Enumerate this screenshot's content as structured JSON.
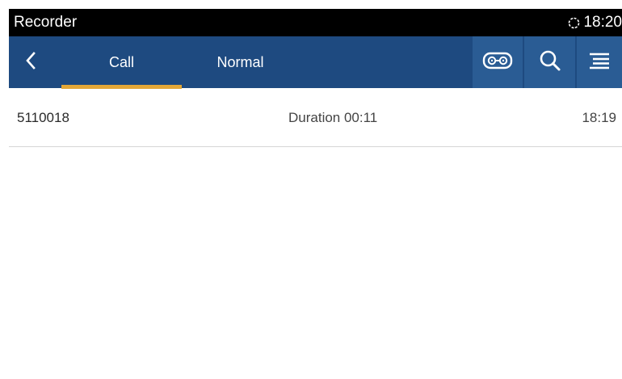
{
  "status_bar": {
    "app_title": "Recorder",
    "sync_icon": "sync-icon",
    "time": "18:20"
  },
  "action_bar": {
    "back_icon": "chevron-left-icon",
    "tabs": [
      {
        "label": "Call",
        "selected": true
      },
      {
        "label": "Normal",
        "selected": false
      }
    ],
    "actions": [
      {
        "name": "tape-icon"
      },
      {
        "name": "search-icon"
      },
      {
        "name": "menu-icon"
      }
    ],
    "colors": {
      "bar": "#1e4a80",
      "button": "#2a5c94",
      "tab_indicator": "#e3a737"
    }
  },
  "recordings": [
    {
      "number": "5110018",
      "duration": "Duration 00:11",
      "time": "18:19"
    }
  ]
}
